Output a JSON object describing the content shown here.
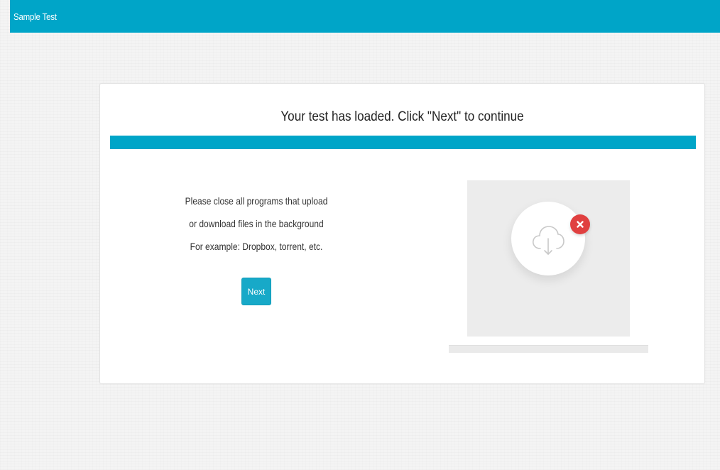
{
  "header": {
    "title": "Sample Test"
  },
  "main": {
    "heading": "Your test has loaded. Click \"Next\" to continue",
    "instructions": [
      "Please close all programs that upload",
      "or download files in the background",
      "For example: Dropbox, torrent, etc."
    ],
    "next_label": "Next",
    "progress_percent": 100
  },
  "illustration": {
    "main_icon": "cloud-download-icon",
    "badge_icon": "close-icon"
  },
  "colors": {
    "accent": "#00a5c8",
    "error": "#e04040"
  }
}
